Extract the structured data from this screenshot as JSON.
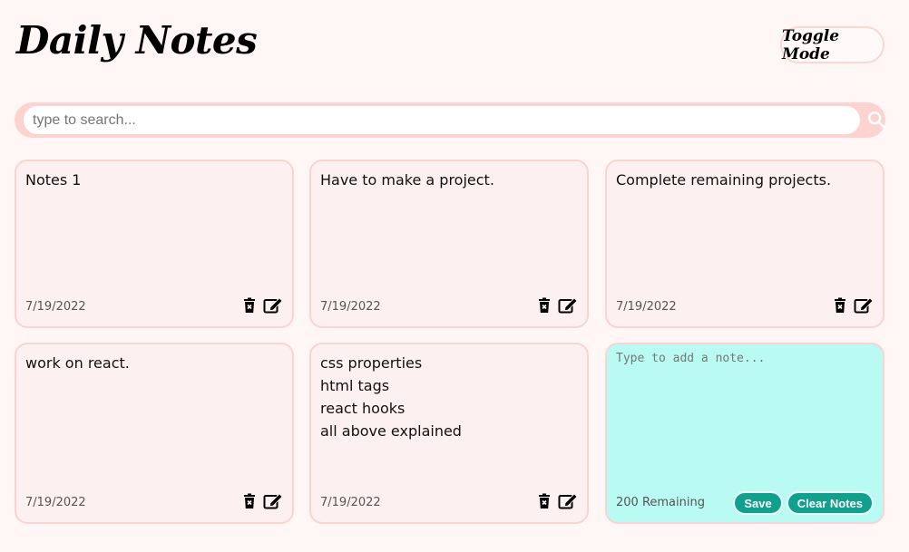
{
  "header": {
    "title": "Daily Notes",
    "toggle_label": "Toggle Mode"
  },
  "search": {
    "placeholder": "type to search...",
    "value": "",
    "icon": "search-icon"
  },
  "notes": [
    {
      "lines": [
        "Notes 1"
      ],
      "date": "7/19/2022"
    },
    {
      "lines": [
        "Have to make a project."
      ],
      "date": "7/19/2022"
    },
    {
      "lines": [
        "Complete remaining projects."
      ],
      "date": "7/19/2022"
    },
    {
      "lines": [
        "work on react."
      ],
      "date": "7/19/2022"
    },
    {
      "lines": [
        "css properties",
        "html tags",
        "react hooks",
        "all above explained"
      ],
      "date": "7/19/2022"
    }
  ],
  "note_icons": {
    "delete": "trash-icon",
    "edit": "edit-icon"
  },
  "new_note": {
    "placeholder": "Type to add a note...",
    "value": "",
    "remaining": "200 Remaining",
    "save_label": "Save",
    "clear_label": "Clear Notes"
  },
  "colors": {
    "background": "#fff7f6",
    "note_bg": "#fdf0f0",
    "note_border": "#fbd3d0",
    "search_bg": "#fcd3d0",
    "new_note_bg": "#b9fbf2",
    "button_bg": "#11a08d"
  }
}
